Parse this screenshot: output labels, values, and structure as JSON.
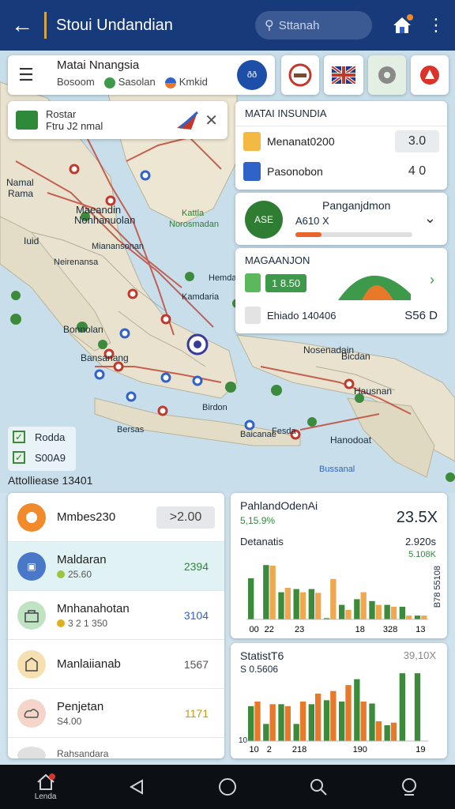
{
  "appbar": {
    "title": "Stoui Undandian",
    "search_placeholder": "Sttanah",
    "home_badge": "",
    "back_icon": "arrow-left-icon",
    "more_icon": "more-vert-icon"
  },
  "location_card": {
    "title": "Matai Nnangsia",
    "chip1": "Bosoom",
    "chip2": "Sasolan",
    "chip3": "Kmkid",
    "nav_btn": "ðð"
  },
  "hospital": {
    "title": "Rostar",
    "subtitle": "Ftru J2 nmal"
  },
  "right_panel": {
    "header": "MATAI INSUNDIA",
    "rows": [
      {
        "label": "Menanat0200",
        "value": "3.0",
        "color": "#f4b942"
      },
      {
        "label": "Pasonobon",
        "value": "4 0",
        "color": "#2f63c8"
      }
    ]
  },
  "pa_card": {
    "title": "Panganjdmon",
    "subtitle": "A610 X",
    "progress": 0.22,
    "logo_text": "ASE"
  },
  "mag_card": {
    "header": "MAGAANJON",
    "pill": "1 8.50",
    "row_label": "Ehiado 140406",
    "row_value": "S56 D"
  },
  "map_labels": {
    "l1": "Namal",
    "l2": "Rama",
    "l3": "Maeandin",
    "l4": "Nonhanuolan",
    "l5": "Kattla",
    "l6": "Norosmadan",
    "l7": "Iuid",
    "l8": "Mianansonan",
    "l9": "Neirenansa",
    "l10": "Bonnolan",
    "l11": "Bansanang",
    "l12": "Nosenadain",
    "l13": "Bicdan",
    "l14": "Hausnan",
    "l15": "Hanodoat",
    "l16": "Bussanal",
    "l17": "Bersas",
    "l18": "Birdon",
    "l19": "Fesda",
    "l20": "Hemdanglor",
    "l21": "Kamdaria",
    "l22": "Baicanae"
  },
  "legend": {
    "item1": "Rodda",
    "item2": "S00A9"
  },
  "section_label": "Attolliease 13401",
  "list": [
    {
      "name": "Mmbes230",
      "sub": "",
      "value": ">2.00",
      "type": "pill",
      "avatar_color": "#f08a2a"
    },
    {
      "name": "Maldaran",
      "sub": "25.60",
      "value": "2394",
      "type": "num",
      "num_color": "#2e8a3a",
      "avatar_color": "#4a78c8",
      "selected": true
    },
    {
      "name": "Mnhanahotan",
      "sub": "3 2 1 350",
      "value": "3104",
      "type": "num",
      "num_color": "#2e63c8",
      "avatar_color": "#bfe3c3"
    },
    {
      "name": "Manlaiianab",
      "sub": "",
      "value": "1567",
      "type": "num",
      "num_color": "#555555",
      "avatar_color": "#f6dfb1"
    },
    {
      "name": "Penjetan",
      "sub": "S4.00",
      "value": "1171",
      "type": "num",
      "num_color": "#c79a10",
      "avatar_color": "#f5d4c9"
    },
    {
      "name": "Rahsandara",
      "sub": "",
      "value": "",
      "type": "num",
      "num_color": "#555555",
      "avatar_color": "#e0e0e0"
    }
  ],
  "chart1": {
    "title": "PahlandOdenAi",
    "big": "23.5X",
    "green": "5,15.9%",
    "label": "Detanatis",
    "right1": "2.920s",
    "right2": "5.108K",
    "rotated": "B78 55108",
    "chart_data": {
      "type": "bar",
      "categories": [
        "00",
        "22",
        "",
        "23",
        "",
        "",
        "",
        "18",
        "",
        "328",
        "",
        "13"
      ],
      "series": [
        {
          "values": [
            6.5,
            8.6,
            4.3,
            4.8,
            4.8,
            0.2,
            2.3,
            3.2,
            2.9,
            2.3,
            2.0,
            0.6
          ],
          "color": "#3c8a3c"
        },
        {
          "values": [
            0,
            8.5,
            5.0,
            4.3,
            4.2,
            6.4,
            1.5,
            4.3,
            2.3,
            2.0,
            0.6,
            0.6
          ],
          "color": "#f0a850"
        }
      ],
      "ylim": [
        0,
        10
      ]
    }
  },
  "chart2": {
    "title": "StatistT6",
    "sub": "S 0.5606",
    "right": "39,10X",
    "ylabel": "10",
    "chart_data": {
      "type": "bar",
      "categories": [
        "10",
        "2",
        "",
        "218",
        "",
        "",
        "",
        "190",
        "",
        "",
        "",
        "19"
      ],
      "series": [
        {
          "values": [
            5.3,
            2.6,
            5.6,
            2.6,
            5.6,
            6.2,
            6.0,
            9.4,
            5.7,
            2.4,
            10.3,
            10.3
          ],
          "color": "#3c8a3c"
        },
        {
          "values": [
            6.0,
            5.6,
            5.3,
            6.0,
            7.2,
            7.6,
            8.5,
            6.0,
            3.0,
            2.8,
            0,
            0
          ],
          "color": "#e8782a"
        }
      ],
      "ylim": [
        0,
        12
      ]
    }
  },
  "bottom_nav": [
    {
      "label": "Lenda",
      "icon": "home-icon"
    },
    {
      "label": "",
      "icon": "back-triangle-icon"
    },
    {
      "label": "",
      "icon": "circle-home-icon"
    },
    {
      "label": "",
      "icon": "search-icon"
    },
    {
      "label": "",
      "icon": "profile-icon"
    }
  ]
}
